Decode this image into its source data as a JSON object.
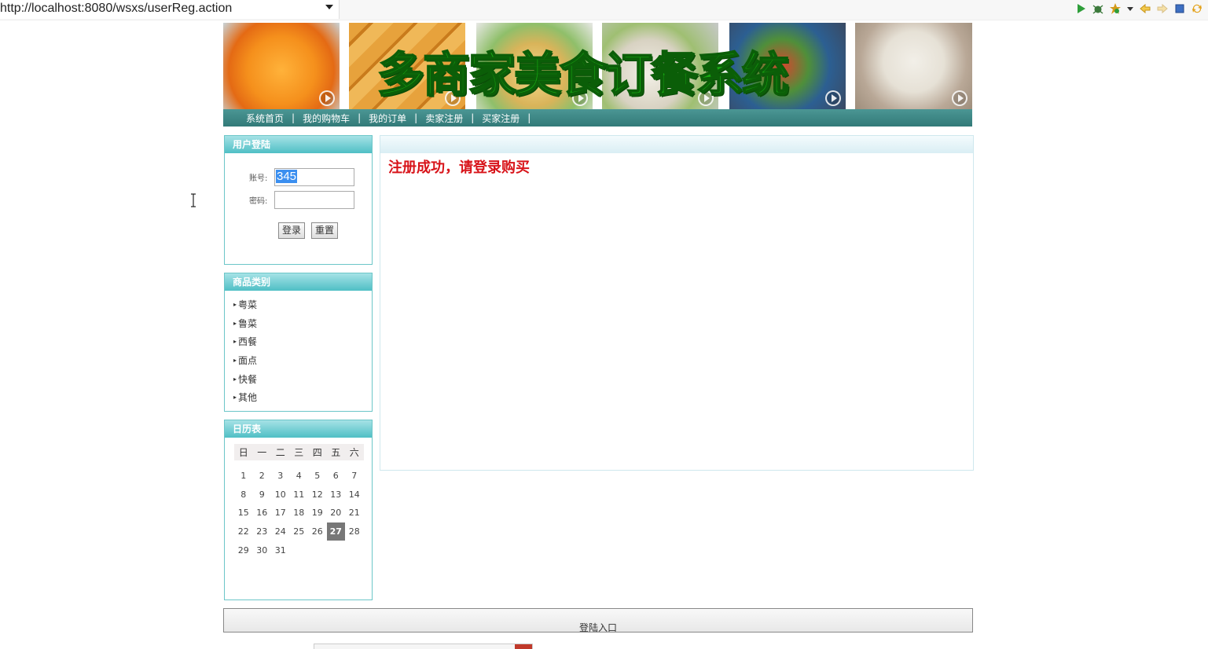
{
  "browser": {
    "url": "http://localhost:8080/wsxs/userReg.action",
    "toolbar_icons": [
      "run-icon",
      "debug-icon",
      "external-tools-icon",
      "dropdown-arrow-icon",
      "back-icon",
      "forward-icon",
      "stop-icon",
      "refresh-icon"
    ]
  },
  "banner": {
    "title": "多商家美食订餐系统"
  },
  "nav": {
    "items": [
      "系统首页",
      "我的购物车",
      "我的订单",
      "卖家注册",
      "买家注册"
    ],
    "separator": "|"
  },
  "login": {
    "title": "用户登陆",
    "account_label": "账号:",
    "account_value": "345",
    "password_label": "密码:",
    "password_value": "",
    "login_button": "登录",
    "reset_button": "重置"
  },
  "categories": {
    "title": "商品类别",
    "bullet": "▸",
    "items": [
      "粤菜",
      "鲁菜",
      "西餐",
      "面点",
      "快餐",
      "其他"
    ]
  },
  "calendar": {
    "title": "日历表",
    "weekdays": [
      "日",
      "一",
      "二",
      "三",
      "四",
      "五",
      "六"
    ],
    "weeks": [
      [
        "1",
        "2",
        "3",
        "4",
        "5",
        "6",
        "7"
      ],
      [
        "8",
        "9",
        "10",
        "11",
        "12",
        "13",
        "14"
      ],
      [
        "15",
        "16",
        "17",
        "18",
        "19",
        "20",
        "21"
      ],
      [
        "22",
        "23",
        "24",
        "25",
        "26",
        "27",
        "28"
      ],
      [
        "29",
        "30",
        "31",
        "",
        "",
        "",
        ""
      ]
    ],
    "today": "27"
  },
  "main": {
    "message": "注册成功，请登录购买"
  },
  "footer": {
    "text": "登陆入口"
  },
  "colors": {
    "nav_bar": "#3a8583",
    "panel_header": "#4fbfc5",
    "panel_border": "#6cc6c8",
    "message_red": "#d8141a",
    "banner_title_green": "#17a812"
  }
}
